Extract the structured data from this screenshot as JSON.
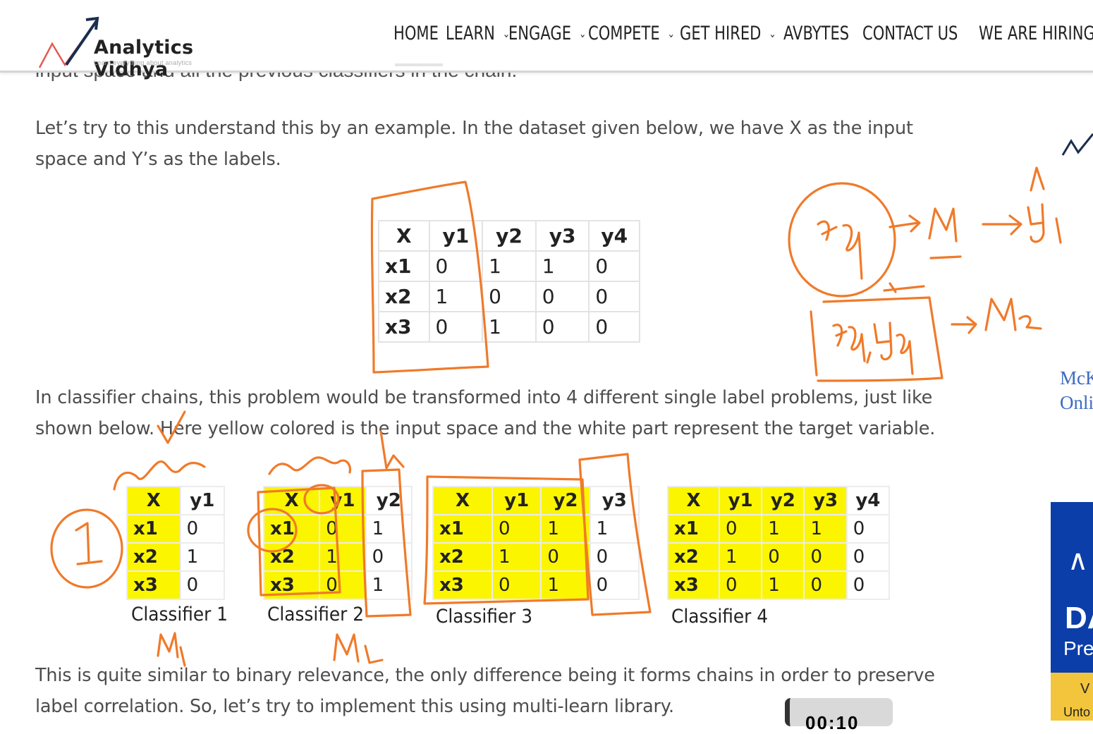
{
  "header": {
    "logo_name": "Analytics Vidhya",
    "logo_tagline": "Learn everything about analytics",
    "nav": [
      {
        "label": "HOME",
        "dropdown": false
      },
      {
        "label": "LEARN",
        "dropdown": true
      },
      {
        "label": "ENGAGE",
        "dropdown": true
      },
      {
        "label": "COMPETE",
        "dropdown": true
      },
      {
        "label": "GET HIRED",
        "dropdown": true
      },
      {
        "label": "AVBYTES",
        "dropdown": false
      },
      {
        "label": "CONTACT US",
        "dropdown": false
      },
      {
        "label": "WE ARE HIRING",
        "dropdown": false
      }
    ]
  },
  "article": {
    "cut_line": "input space and all the previous classifiers in the chain.",
    "para1": [
      "Let’s try to this understand this by an example. In the dataset given below, we have X as the input",
      "space and Y’s as the labels."
    ],
    "para2": [
      "In classifier chains, this problem would be transformed into 4 different single label problems, just like",
      "shown below. Here yellow colored is the input space and the white part represent the target variable."
    ],
    "para3": [
      "This is quite similar to binary relevance, the only difference being it forms chains in order to preserve",
      "label correlation. So, let’s try to implement this using multi-learn library."
    ],
    "main_table": {
      "headers": [
        "X",
        "y1",
        "y2",
        "y3",
        "y4"
      ],
      "rows": [
        [
          "x1",
          "0",
          "1",
          "1",
          "0"
        ],
        [
          "x2",
          "1",
          "0",
          "0",
          "0"
        ],
        [
          "x3",
          "0",
          "1",
          "0",
          "0"
        ]
      ]
    },
    "classifiers": [
      {
        "caption": "Classifier 1",
        "headers": [
          "X",
          "y1"
        ],
        "rows": [
          [
            "x1",
            "0"
          ],
          [
            "x2",
            "1"
          ],
          [
            "x3",
            "0"
          ]
        ]
      },
      {
        "caption": "Classifier 2",
        "headers": [
          "X",
          "y1",
          "y2"
        ],
        "rows": [
          [
            "x1",
            "0",
            "1"
          ],
          [
            "x2",
            "1",
            "0"
          ],
          [
            "x3",
            "0",
            "1"
          ]
        ]
      },
      {
        "caption": "Classifier 3",
        "headers": [
          "X",
          "y1",
          "y2",
          "y3"
        ],
        "rows": [
          [
            "x1",
            "0",
            "1",
            "1"
          ],
          [
            "x2",
            "1",
            "0",
            "0"
          ],
          [
            "x3",
            "0",
            "1",
            "0"
          ]
        ]
      },
      {
        "caption": "Classifier 4",
        "headers": [
          "X",
          "y1",
          "y2",
          "y3",
          "y4"
        ],
        "rows": [
          [
            "x1",
            "0",
            "1",
            "1",
            "0"
          ],
          [
            "x2",
            "1",
            "0",
            "0",
            "0"
          ],
          [
            "x3",
            "0",
            "1",
            "0",
            "0"
          ]
        ]
      }
    ]
  },
  "sidebar": {
    "link_line1": "McK",
    "link_line2": "Onli",
    "ad_title": "DA",
    "ad_sub": "Pre",
    "ad_band1": "V",
    "ad_band2": "Unto"
  },
  "timer": "00:10",
  "colors": {
    "highlight": "#fbf500",
    "annotation": "#f07a2a",
    "link": "#3d6cc0",
    "ad_bg": "#0b3ea8"
  }
}
